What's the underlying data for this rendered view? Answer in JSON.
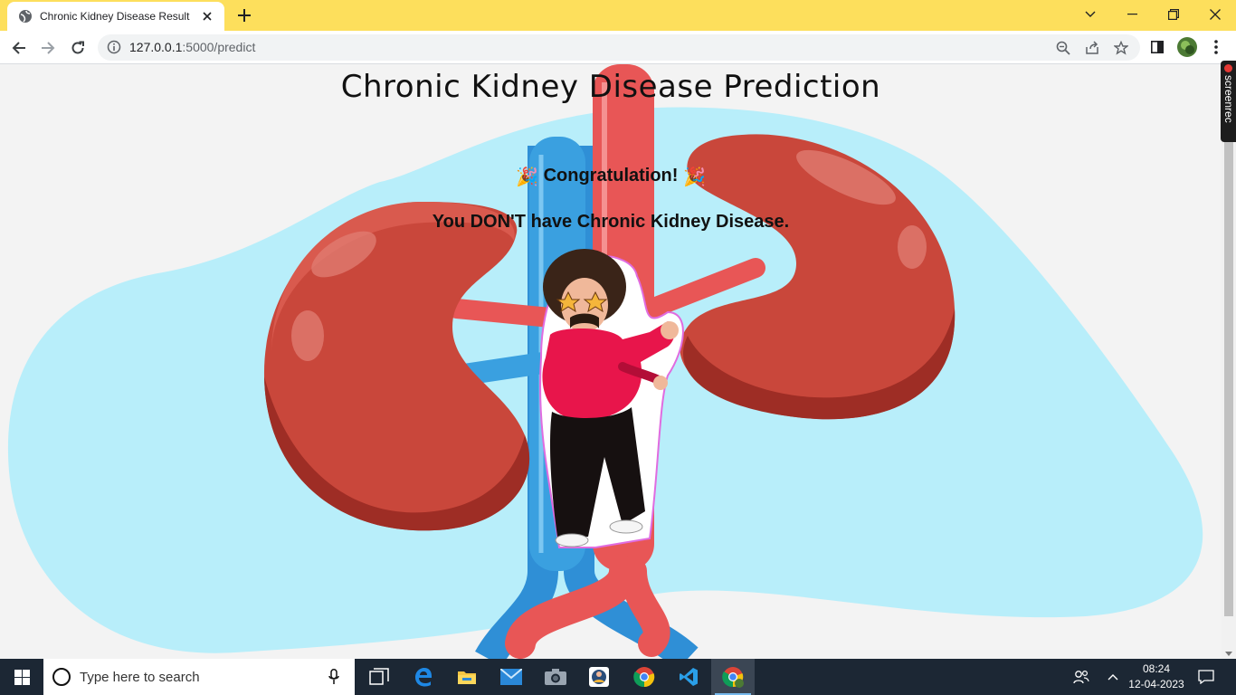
{
  "browser": {
    "tab": {
      "title": "Chronic Kidney Disease Result"
    },
    "url": {
      "host": "127.0.0.1",
      "path": ":5000/predict"
    }
  },
  "page": {
    "title": "Chronic Kidney Disease Prediction",
    "congrats": "Congratulation!",
    "result": "You DON'T have Chronic Kidney Disease.",
    "party_emoji": "🎉"
  },
  "overlay": {
    "recorder_label": "screenrec"
  },
  "taskbar": {
    "search_placeholder": "Type here to search",
    "time": "08:24",
    "date": "12-04-2023",
    "apps": [
      "task-view",
      "edge",
      "file-explorer",
      "mail",
      "camera",
      "photos",
      "chrome",
      "vscode",
      "chrome-active"
    ]
  },
  "colors": {
    "tabbar": "#fddf5c",
    "taskbar": "#1c2734",
    "kidney": "#c9473b",
    "artery": "#e85656",
    "vein": "#3399dd",
    "blob": "#b8eefa"
  }
}
